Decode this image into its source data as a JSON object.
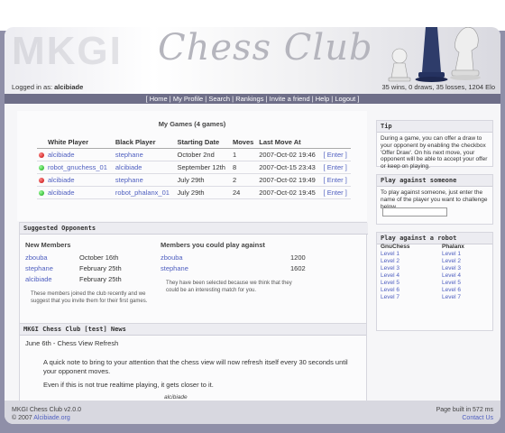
{
  "header": {
    "watermark": "MKGI",
    "brand": "Chess Club",
    "login_prefix": "Logged in as:",
    "login_user": "alcibiade",
    "record": "35 wins, 0 draws, 35 losses, 1204 Elo"
  },
  "nav": [
    "Home",
    "My Profile",
    "Search",
    "Rankings",
    "Invite a friend",
    "Help",
    "Logout"
  ],
  "games": {
    "title": "My Games (4 games)",
    "columns": [
      "White Player",
      "Black Player",
      "Starting Date",
      "Moves",
      "Last Move At"
    ],
    "rows": [
      {
        "status": "red",
        "white": "alcibiade",
        "black": "stephane",
        "date": "October 2nd",
        "moves": "1",
        "last": "2007-Oct-02 19:46",
        "action": "[ Enter ]"
      },
      {
        "status": "green",
        "white": "robot_gnuchess_01",
        "black": "alcibiade",
        "date": "September 12th",
        "moves": "8",
        "last": "2007-Oct-15 23:43",
        "action": "[ Enter ]"
      },
      {
        "status": "red",
        "white": "alcibiade",
        "black": "stephane",
        "date": "July 29th",
        "moves": "2",
        "last": "2007-Oct-02 19:49",
        "action": "[ Enter ]"
      },
      {
        "status": "green",
        "white": "alcibiade",
        "black": "robot_phalanx_01",
        "date": "July 29th",
        "moves": "24",
        "last": "2007-Oct-02 19:45",
        "action": "[ Enter ]"
      }
    ]
  },
  "opponents": {
    "header": "Suggested Opponents",
    "new_members_title": "New Members",
    "new_members": [
      {
        "name": "zbouba",
        "date": "October 16th"
      },
      {
        "name": "stephane",
        "date": "February 25th"
      },
      {
        "name": "alcibiade",
        "date": "February 25th"
      }
    ],
    "new_note": "These members joined the club recently and we suggest that you invite them for their first games.",
    "could_play_title": "Members you could play against",
    "could_play": [
      {
        "name": "zbouba",
        "elo": "1200"
      },
      {
        "name": "stephane",
        "elo": "1602"
      }
    ],
    "could_note": "They have been selected because we think that they could be an interesting match for you."
  },
  "news": {
    "header": "MKGI Chess Club [test] News",
    "title": "June 6th - Chess View Refresh",
    "para1": "A quick note to bring to your attention that the chess view will now refresh itself every 30 seconds until your opponent moves.",
    "para2": "Even if this is not true realtime playing, it gets closer to it.",
    "signature": "alcibiade"
  },
  "sidebar": {
    "tip_header": "Tip",
    "tip_text": "During a game, you can offer a draw to your opponent by enabling the checkbox 'Offer Draw'. On his next move, your opponent will be able to accept your offer or keep on playing.",
    "play_header": "Play against someone",
    "play_text": "To play against someone, just enter the name of the player you want to challenge below.",
    "play_input_value": "",
    "robot_header": "Play against a robot",
    "gnuchess_title": "GnuChess",
    "phalanx_title": "Phalanx",
    "levels": [
      "Level 1",
      "Level 2",
      "Level 3",
      "Level 4",
      "Level 5",
      "Level 6",
      "Level 7"
    ]
  },
  "footer": {
    "version": "MKGI Chess Club v2.0.0",
    "copyright": "© 2007",
    "copyright_link": "Alcibiade.org",
    "build": "Page built in 572 ms",
    "contact": "Contact Us"
  },
  "colors": {
    "background": "#8f8fa8",
    "navbar": "#6e6e88",
    "link": "#5060c0"
  }
}
